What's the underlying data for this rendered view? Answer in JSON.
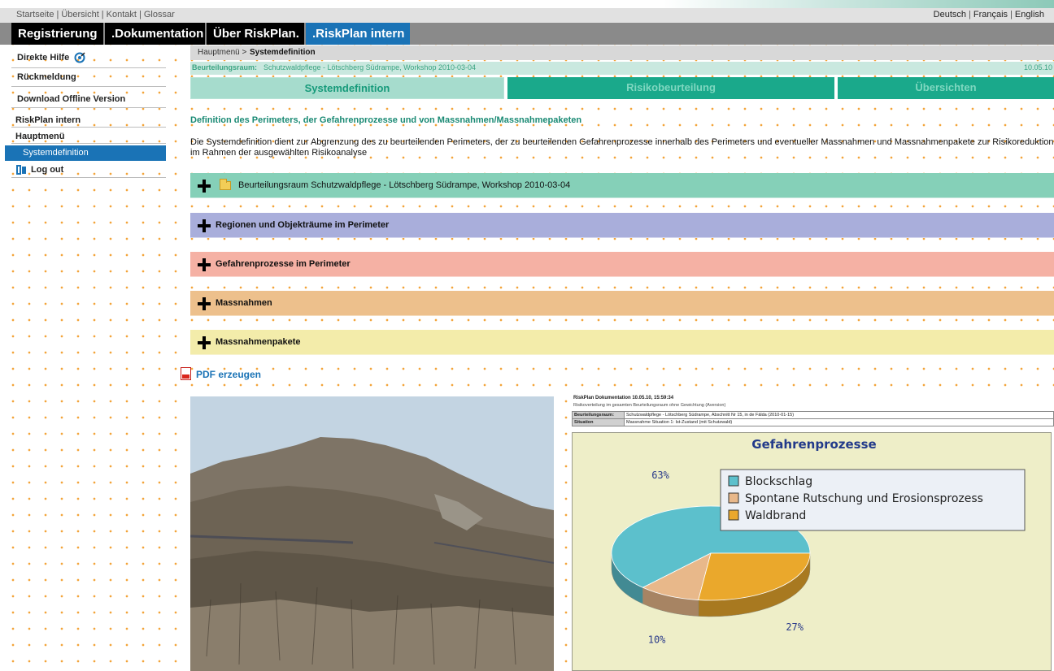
{
  "top_links": [
    "Startseite",
    "Übersicht",
    "Kontakt",
    "Glossar"
  ],
  "languages": [
    "Deutsch",
    "Français",
    "English"
  ],
  "main_nav": [
    {
      "label": "Registrierung",
      "active": false
    },
    {
      "label": ".Dokumentation .",
      "active": false
    },
    {
      "label": "Über RiskPlan.",
      "active": false
    },
    {
      "label": ".RiskPlan intern",
      "active": true
    }
  ],
  "sidebar": {
    "direct_help": "Direkte Hilfe",
    "feedback": "Rückmeldung",
    "download": "Download Offline Version",
    "section_title": "RiskPlan intern",
    "menu_title": "Hauptmenü",
    "selected_item": "Systemdefinition",
    "logout": "Log out"
  },
  "breadcrumb": {
    "parent": "Hauptmenü >",
    "current": "Systemdefinition"
  },
  "evaluation": {
    "label": "Beurteilungsraum:",
    "value": "Schutzwaldpflege - Lötschberg Südrampe, Workshop 2010-03-04",
    "date": "10.05.10"
  },
  "subtabs": [
    {
      "label": "Systemdefinition",
      "active": true
    },
    {
      "label": "Risikobeurteilung",
      "active": false
    },
    {
      "label": "Übersichten",
      "active": false
    }
  ],
  "heading": "Definition des Perimeters, der Gefahrenprozesse und von Massnahmen/Massnahmepaketen",
  "intro": "Die Systemdefinition dient zur Abgrenzung des zu beurteilenden Perimeters, der zu beurteilenden Gefahrenprozesse innerhalb des Perimeters und eventueller Massnahmen und Massnahmenpakete zur Risikoreduktion im Rahmen der ausgewählten Risikoanalyse",
  "sections": [
    {
      "label": "Beurteilungsraum Schutzwaldpflege - Lötschberg Südrampe, Workshop 2010-03-04",
      "color": "#85d0b8",
      "icon": "folder-icon"
    },
    {
      "label": "Regionen und Objekträume im Perimeter",
      "color": "#a9aedb"
    },
    {
      "label": "Gefahrenprozesse im Perimeter",
      "color": "#f5b1a4"
    },
    {
      "label": "Massnahmen",
      "color": "#edc08c"
    },
    {
      "label": "Massnahmenpakete",
      "color": "#f3ecaa"
    }
  ],
  "pdf_label": "PDF erzeugen",
  "report": {
    "title": "RiskPlan Dokumentation 10.05.10, 15:59:34",
    "subtitle": "Risikoverteilung im gesamten Beurteilungsraum ohne Gewichtung (Aversion)",
    "rows": [
      {
        "key": "Beurteilungsraum:",
        "value": "Schutzwaldpflege - Lötschberg Südrampe, Abschnitt Nr 15, in de Fälda (2010-01-15)"
      },
      {
        "key": "Situation",
        "value": "Massnahme Situation 1: Ist-Zustand (mit Schutzwald)"
      }
    ]
  },
  "chart_data": {
    "type": "pie",
    "title": "Gefahrenprozesse",
    "legend_position": "top-right",
    "slices": [
      {
        "name": "Blockschlag",
        "value": 63,
        "label": "63%",
        "color": "#5cc0cc"
      },
      {
        "name": "Spontane Rutschung und Erosionsprozess",
        "value": 10,
        "label": "10%",
        "color": "#e8b88a"
      },
      {
        "name": "Waldbrand",
        "value": 27,
        "label": "27%",
        "color": "#eaa82c"
      }
    ]
  }
}
